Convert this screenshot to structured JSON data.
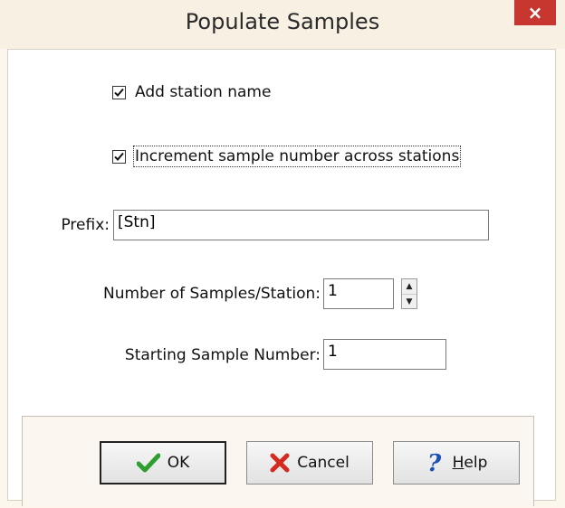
{
  "window": {
    "title": "Populate Samples",
    "close_glyph": "×"
  },
  "options": {
    "add_station_name": {
      "label": "Add station name",
      "checked": true
    },
    "increment_sample_number": {
      "label": "Increment sample number across stations",
      "checked": true
    }
  },
  "fields": {
    "prefix": {
      "label": "Prefix:",
      "value": "[Stn]"
    },
    "samples_per_station": {
      "label": "Number of Samples/Station:",
      "value": "1"
    },
    "starting_sample_number": {
      "label": "Starting Sample Number:",
      "value": "1"
    }
  },
  "buttons": {
    "ok": {
      "label": "OK",
      "icon": "checkmark-icon",
      "color": "#2e9e2e"
    },
    "cancel": {
      "label": "Cancel",
      "icon": "x-icon",
      "color": "#d42b1e"
    },
    "help": {
      "label": "Help",
      "icon": "question-icon",
      "color": "#1f4fb8"
    }
  }
}
